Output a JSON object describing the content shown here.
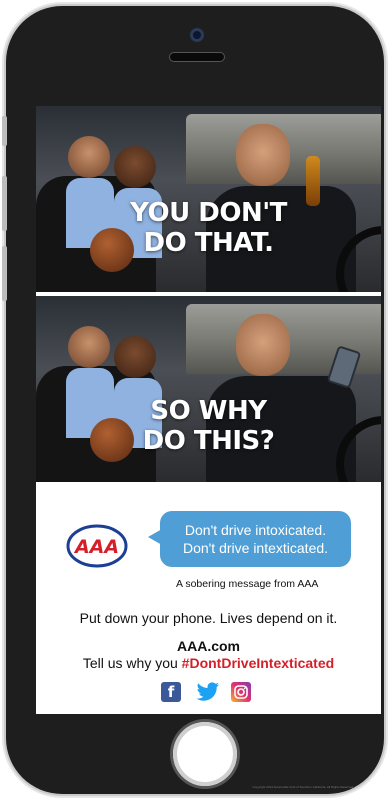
{
  "ad": {
    "panel1": {
      "line1": "YOU DON'T",
      "line2": "DO THAT."
    },
    "panel2": {
      "line1": "SO WHY",
      "line2": "DO THIS?"
    },
    "logo_text": "AAA",
    "bubble": {
      "line1": "Don't drive intoxicated.",
      "line2": "Don't drive intexticated."
    },
    "sobering": "A sobering message from AAA",
    "put_down": "Put down your phone. Lives depend on it.",
    "site": "AAA.com",
    "tell_us": "Tell us why you",
    "hashtag": "#DontDriveIntexticated",
    "social": [
      "facebook-icon",
      "twitter-icon",
      "instagram-icon"
    ],
    "fine_print": "Copyright 2014 Automobile Club of Southern California. All Rights Reserved."
  },
  "colors": {
    "bubble": "#4f9fd6",
    "hashtag": "#d41f28",
    "aaa_red": "#d41f28",
    "aaa_blue": "#1c3f94",
    "facebook": "#3b5998",
    "twitter": "#1da1f2"
  }
}
